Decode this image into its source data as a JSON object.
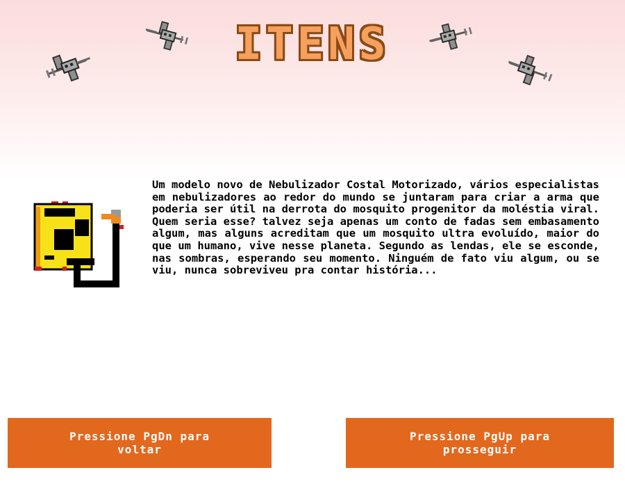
{
  "title": "ITENS",
  "item": {
    "icon": "motorized-backpack-fogger-icon",
    "description": "Um modelo novo de Nebulizador Costal Motorizado, vários especialistas em nebulizadores ao redor do mundo se juntaram para criar a arma que poderia ser útil na derrota do mosquito progenitor da moléstia viral. Quem seria esse? talvez seja apenas um conto de fadas sem embasamento algum, mas alguns acreditam que um mosquito ultra evoluído, maior do que um humano, vive nesse planeta. Segundo as lendas, ele se esconde, nas sombras, esperando seu momento. Ninguém de fato viu algum, ou se viu, nunca sobreviveu pra contar história..."
  },
  "buttons": {
    "back_label": "Pressione PgDn para voltar",
    "next_label": "Pressione PgUp para prosseguir"
  },
  "decorations": [
    "mosquito-icon",
    "mosquito-icon",
    "mosquito-icon",
    "mosquito-icon"
  ],
  "colors": {
    "title_fill": "#f6a05e",
    "title_outline": "#8a4a16",
    "button_bg": "#e2681e",
    "button_text": "#ffffff",
    "bg_top": "#fbdcdc"
  }
}
